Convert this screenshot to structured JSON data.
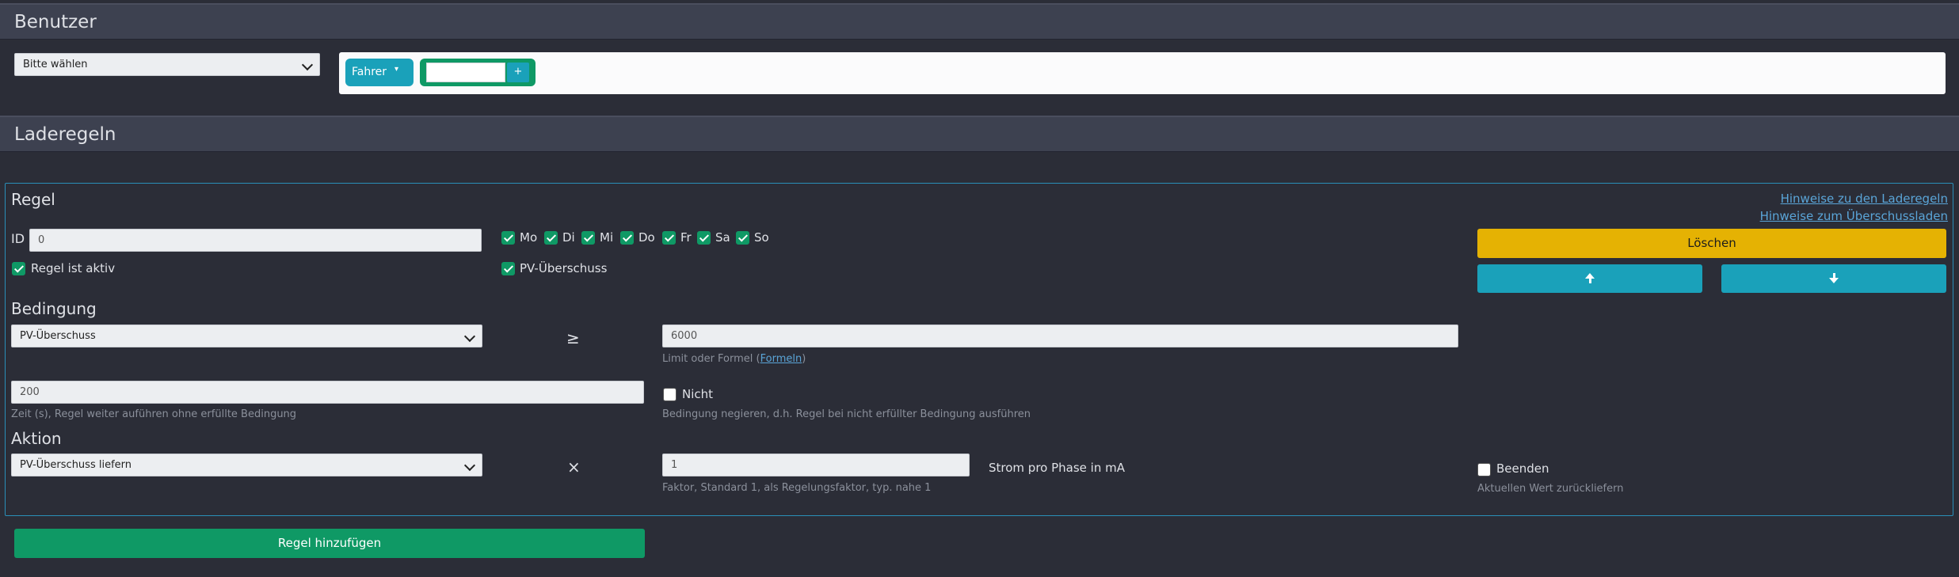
{
  "benutzer": {
    "title": "Benutzer",
    "select_value": "Bitte wählen",
    "tag_label": "Fahrer",
    "tag_caret": "▾",
    "add_input_value": "",
    "add_button": "+"
  },
  "laderegeln": {
    "title": "Laderegeln"
  },
  "regel": {
    "title": "Regel",
    "hint_link_1": "Hinweise zu den Laderegeln",
    "hint_link_2": "Hinweise zum Überschussladen",
    "id_label": "ID",
    "id_value": "0",
    "active_label": "Regel ist aktiv",
    "days": [
      {
        "label": "Mo",
        "checked": true
      },
      {
        "label": "Di",
        "checked": true
      },
      {
        "label": "Mi",
        "checked": true
      },
      {
        "label": "Do",
        "checked": true
      },
      {
        "label": "Fr",
        "checked": true
      },
      {
        "label": "Sa",
        "checked": true
      },
      {
        "label": "So",
        "checked": true
      }
    ],
    "pv_label": "PV-Überschuss",
    "delete_button": "Löschen",
    "up_icon": "arrow-up-icon",
    "down_icon": "arrow-down-icon"
  },
  "bedingung": {
    "title": "Bedingung",
    "select_value": "PV-Überschuss",
    "operator": "≥",
    "limit_value": "6000",
    "limit_hint_prefix": "Limit oder Formel (",
    "limit_hint_link": "Formeln",
    "limit_hint_suffix": ")",
    "time_value": "200",
    "time_hint": "Zeit (s), Regel weiter auführen ohne erfüllte Bedingung",
    "negate_label": "Nicht",
    "negate_hint": "Bedingung negieren, d.h. Regel bei nicht erfüllter Bedingung ausführen"
  },
  "aktion": {
    "title": "Aktion",
    "select_value": "PV-Überschuss liefern",
    "operator": "×",
    "factor_value": "1",
    "factor_unit": "Strom pro Phase in mA",
    "factor_hint": "Faktor, Standard 1, als Regelungsfaktor, typ. nahe 1",
    "finish_label": "Beenden",
    "finish_hint": "Aktuellen Wert zurückliefern"
  },
  "add_rule_button": "Regel hinzufügen",
  "colors": {
    "background": "#2b2d37",
    "header": "#3d4150",
    "teal": "#1aa1ba",
    "green": "#0f9965",
    "yellow": "#e5b203",
    "rule_border": "#2a8fb8"
  }
}
